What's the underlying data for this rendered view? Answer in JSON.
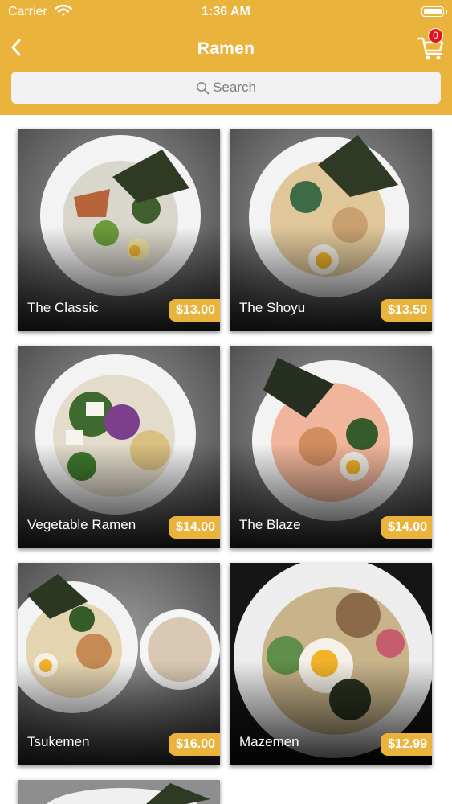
{
  "status_bar": {
    "carrier": "Carrier",
    "time": "1:36 AM"
  },
  "nav": {
    "title": "Ramen",
    "cart_count": "0"
  },
  "search": {
    "placeholder": "Search"
  },
  "colors": {
    "accent": "#E9B33C",
    "badge": "#e4141c"
  },
  "items": [
    {
      "name": "The Classic",
      "price": "$13.00"
    },
    {
      "name": "The Shoyu",
      "price": "$13.50"
    },
    {
      "name": "Vegetable Ramen",
      "price": "$14.00"
    },
    {
      "name": "The Blaze",
      "price": "$14.00"
    },
    {
      "name": "Tsukemen",
      "price": "$16.00"
    },
    {
      "name": "Mazemen",
      "price": "$12.99"
    }
  ]
}
